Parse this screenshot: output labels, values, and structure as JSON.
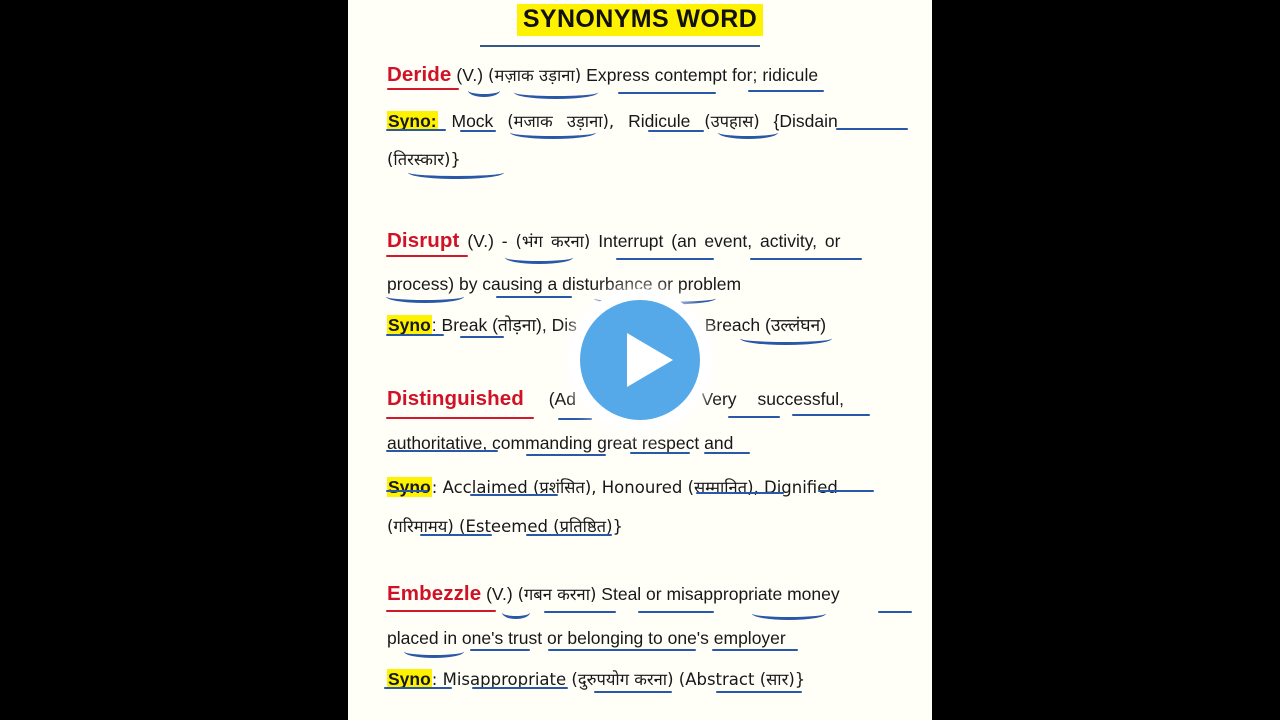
{
  "media": {
    "play_button_label": "Play",
    "accent_blue": "#55a9e8",
    "letterbox_color": "#000000"
  },
  "page": {
    "background": "#fffef7",
    "highlight_color": "#fff200",
    "headword_color": "#d01228",
    "underline_color": "#2a58a8",
    "title": "SYNONYMS WORD"
  },
  "entries": [
    {
      "headword": "Deride",
      "pos": "(V.)",
      "hindi": "(मज़ाक उड़ाना)",
      "definition": "Express contempt for; ridicule",
      "syno_label": "Syno:",
      "syno_line1": "Mock",
      "syno_hindi1": "(मजाक  उड़ाना),",
      "syno_line2": "Ridicule",
      "syno_hindi2": "(उपहास)",
      "syno_line3": "{Disdain",
      "syno_wrap": "(तिरस्कार)}"
    },
    {
      "headword": "Disrupt",
      "pos": "(V.) -",
      "hindi": "(भंग करना)",
      "definition_l1": "Interrupt (an  event,  activity,  or",
      "definition_l2": "process) by causing a disturbance or problem",
      "syno_label": "Syno",
      "syno_text_start": ": Break (तोड़ना), Dis",
      "syno_text_end": "रना), Breach (उल्लंघन)"
    },
    {
      "headword": "Distinguished",
      "pos_start": "(Ad",
      "pos_end": ")",
      "definition_l1_a": "Very",
      "definition_l1_b": "successful,",
      "definition_l2": "authoritative, commanding great respect and",
      "syno_label": "Syno",
      "syno_line1": ": Acclaimed (प्रशंसित),  Honoured (सम्मानित),  Dignified",
      "syno_line2": "(गरिमामय) (Esteemed (प्रतिष्ठित)}"
    },
    {
      "headword": "Embezzle",
      "pos": "(V.)",
      "hindi": "(गबन करना)",
      "definition_l1": "Steal or misappropriate money",
      "definition_l2": "placed in one's trust or belonging to one's employer",
      "syno_label": "Syno",
      "syno_line1": ": Misappropriate (दुरुपयोग करना) (Abstract (सार)}"
    }
  ]
}
